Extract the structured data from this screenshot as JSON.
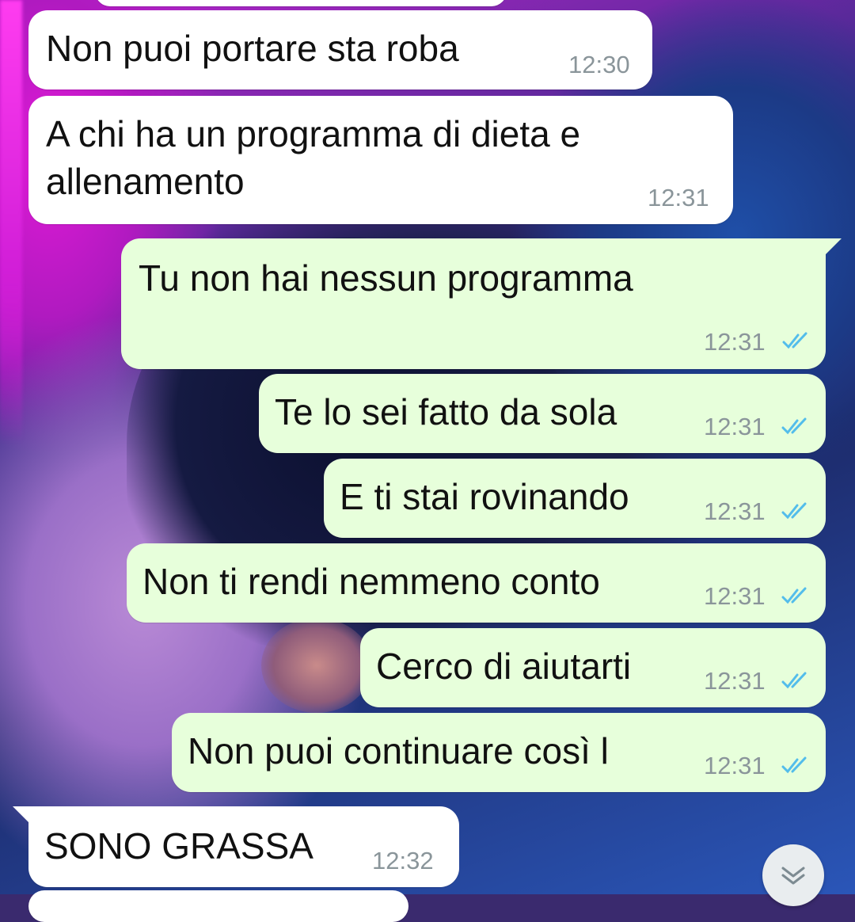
{
  "chat": {
    "messages": [
      {
        "text": "Non puoi portare sta roba",
        "time": "12:30",
        "direction": "incoming"
      },
      {
        "text_line1": "A chi ha un programma di dieta e",
        "text_line2": "allenamento",
        "time": "12:31",
        "direction": "incoming"
      },
      {
        "text": "Tu non hai nessun programma",
        "time": "12:31",
        "direction": "outgoing",
        "status": "read"
      },
      {
        "text": "Te lo sei fatto da sola",
        "time": "12:31",
        "direction": "outgoing",
        "status": "read"
      },
      {
        "text": "E ti stai rovinando",
        "time": "12:31",
        "direction": "outgoing",
        "status": "read"
      },
      {
        "text": "Non ti rendi nemmeno conto",
        "time": "12:31",
        "direction": "outgoing",
        "status": "read"
      },
      {
        "text": "Cerco di aiutarti",
        "time": "12:31",
        "direction": "outgoing",
        "status": "read"
      },
      {
        "text": "Non puoi continuare così l",
        "time": "12:31",
        "direction": "outgoing",
        "status": "read"
      },
      {
        "text": "SONO GRASSA",
        "time": "12:32",
        "direction": "incoming"
      }
    ]
  },
  "colors": {
    "incoming_bubble": "#ffffff",
    "outgoing_bubble": "#e7ffdb",
    "read_ticks": "#53bdeb",
    "timestamp": "#8a959a"
  },
  "icons": {
    "read_receipt": "double-check-icon",
    "scroll_down": "chevron-double-down-icon"
  }
}
